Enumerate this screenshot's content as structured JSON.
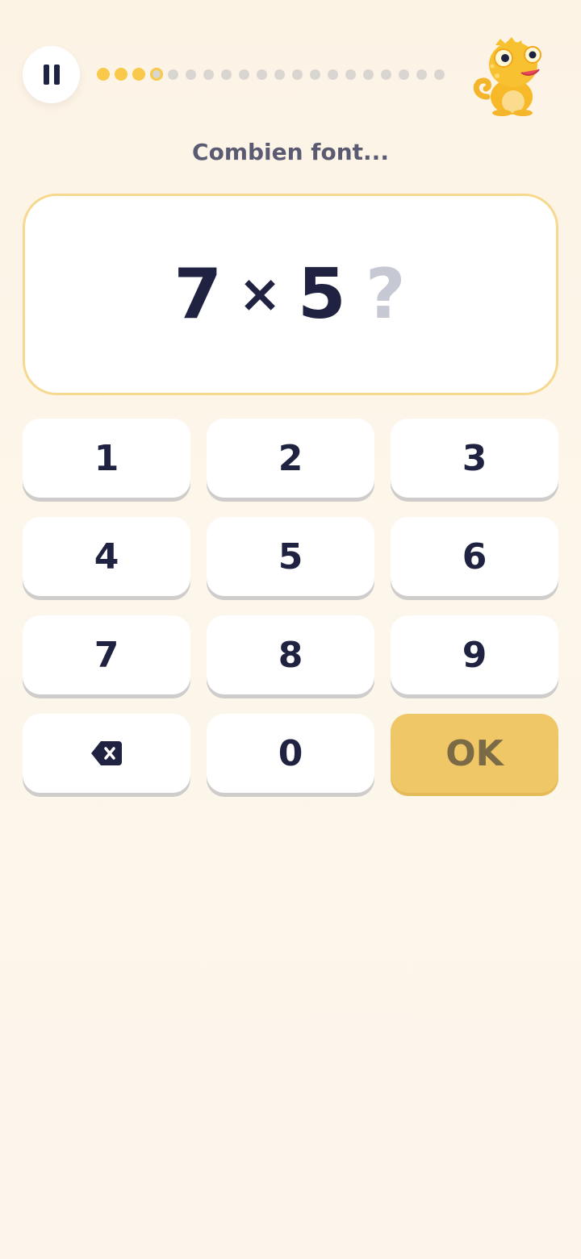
{
  "header": {
    "progress": {
      "total": 20,
      "completed": 3,
      "current_index": 3
    },
    "colors": {
      "done": "#f9c94b",
      "pending": "#d9d6d1"
    }
  },
  "prompt": "Combien font...",
  "question": {
    "left": "7",
    "operator": "×",
    "right": "5",
    "placeholder": "?"
  },
  "keypad": {
    "keys": [
      "1",
      "2",
      "3",
      "4",
      "5",
      "6",
      "7",
      "8",
      "9"
    ],
    "backspace_icon": "backspace-icon",
    "zero": "0",
    "ok": "OK"
  },
  "colors": {
    "text": "#1f2240",
    "card_border": "#f6d98f",
    "ok_button": "#efc766"
  }
}
